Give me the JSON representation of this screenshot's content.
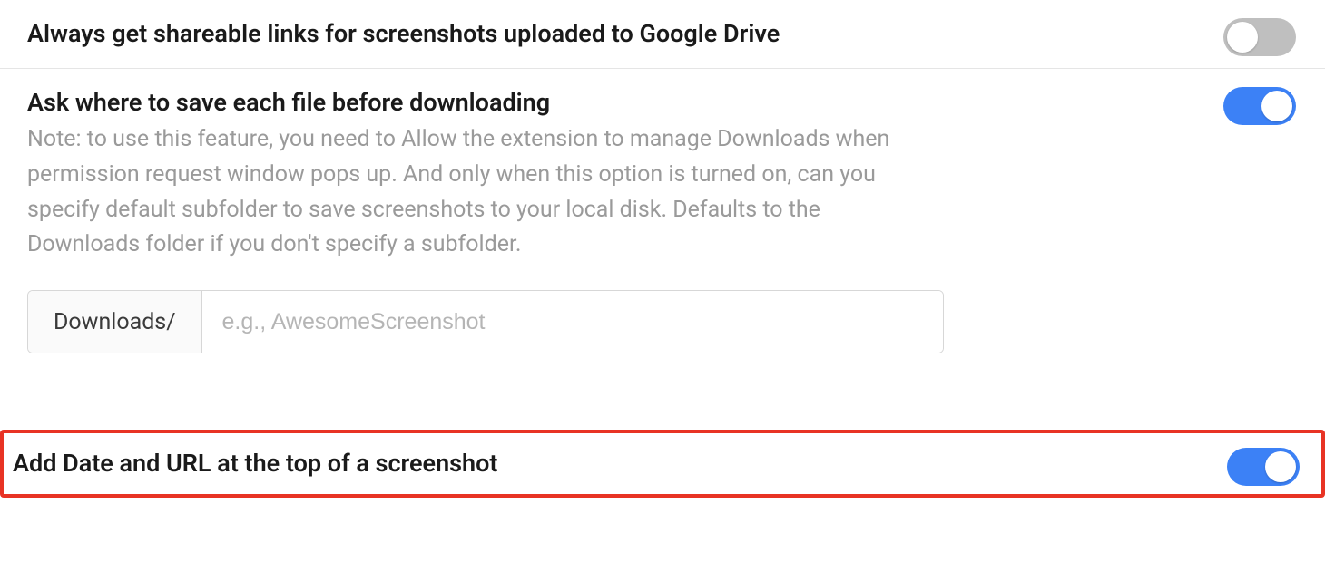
{
  "settings": {
    "shareableLinks": {
      "title": "Always get shareable links for screenshots uploaded to Google Drive",
      "enabled": false
    },
    "askWhereSave": {
      "title": "Ask where to save each file before downloading",
      "desc": "Note: to use this feature, you need to Allow the extension to manage Downloads when permission request window pops up. And only when this option is turned on, can you specify default subfolder to save screenshots to your local disk. Defaults to the Downloads folder if you don't specify a subfolder.",
      "enabled": true,
      "pathPrefix": "Downloads/",
      "pathPlaceholder": "e.g., AwesomeScreenshot",
      "pathValue": ""
    },
    "addDateUrl": {
      "title": "Add Date and URL at the top of a screenshot",
      "enabled": true
    }
  }
}
